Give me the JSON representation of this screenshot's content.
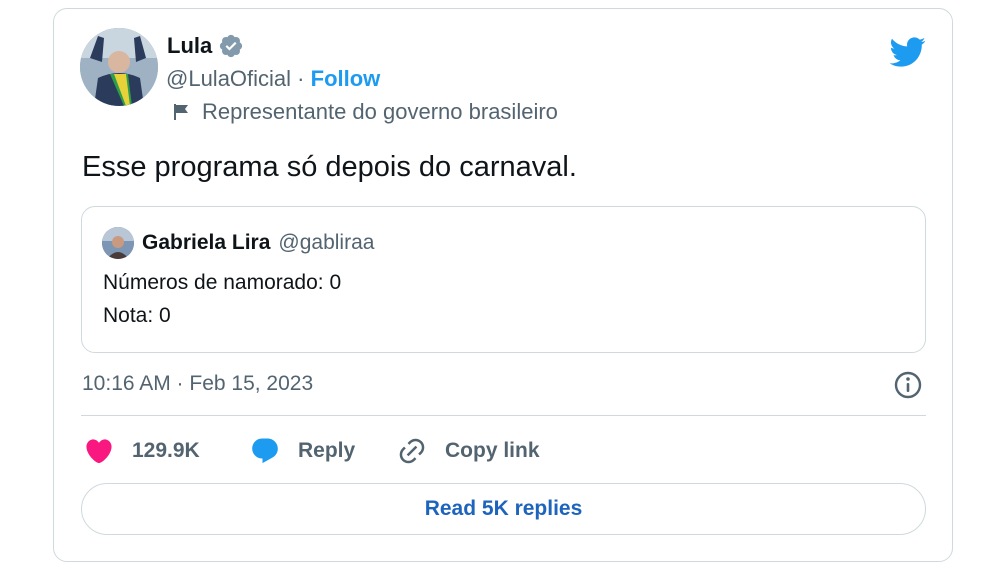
{
  "author": {
    "name": "Lula",
    "handle": "@LulaOficial",
    "separator": " · ",
    "follow_label": "Follow",
    "label": "Representante do governo brasileiro"
  },
  "tweet": {
    "text": "Esse programa só depois do carnaval.",
    "timestamp": "10:16 AM · Feb 15, 2023"
  },
  "quote": {
    "name": "Gabriela Lira",
    "handle": "@gabliraa",
    "lines": [
      "Números de namorado: 0",
      "Nota: 0"
    ]
  },
  "actions": {
    "like_count": "129.9K",
    "reply_label": "Reply",
    "copy_label": "Copy link"
  },
  "read_replies_label": "Read 5K replies",
  "colors": {
    "accent": "#1d9bf0",
    "like": "#f91880",
    "read_button": "#1d64bd",
    "muted": "#536471"
  },
  "icons": [
    "verified-badge-icon",
    "flag-icon",
    "twitter-bird-icon",
    "info-icon",
    "heart-icon",
    "reply-bubble-icon",
    "link-icon"
  ]
}
